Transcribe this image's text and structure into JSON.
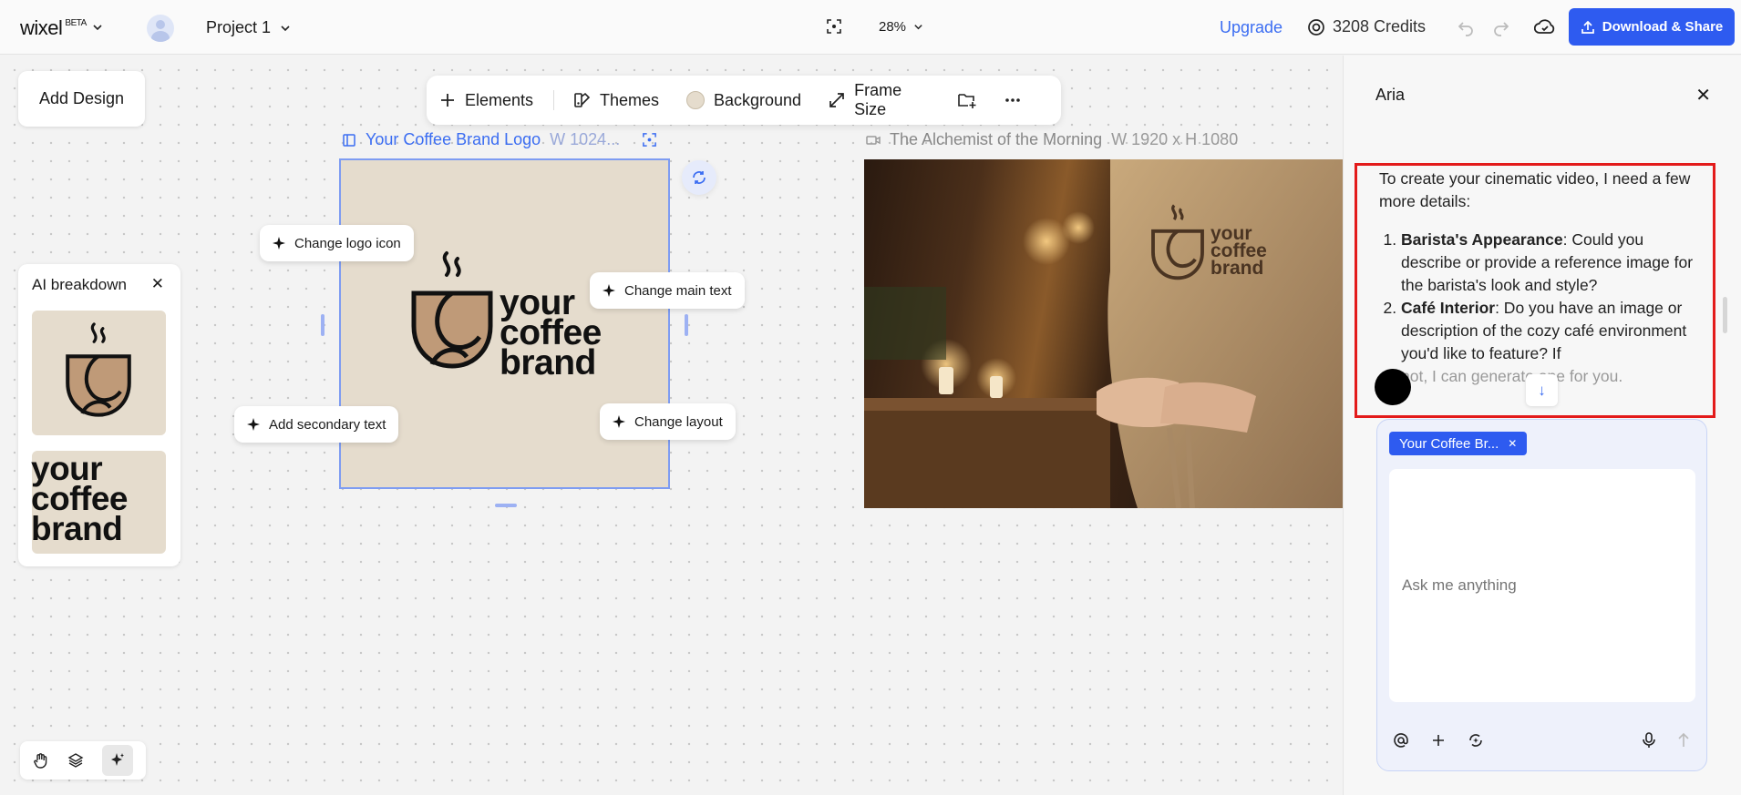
{
  "header": {
    "app_name": "wixel",
    "beta": "BETA",
    "project_name": "Project 1",
    "zoom": "28%",
    "upgrade": "Upgrade",
    "credits": "3208 Credits",
    "download_share": "Download & Share"
  },
  "canvas": {
    "add_design": "Add Design",
    "toolbar": {
      "elements": "Elements",
      "themes": "Themes",
      "background": "Background",
      "frame_size": "Frame Size"
    },
    "frame1": {
      "title": "Your Coffee Brand Logo",
      "dims": "W 1024...",
      "brand_line1": "your",
      "brand_line2": "coffee",
      "brand_line3": "brand"
    },
    "frame2": {
      "title": "The Alchemist of the Morning",
      "dims": "W 1920 x H 1080",
      "apron_line1": "your",
      "apron_line2": "coffee",
      "apron_line3": "brand"
    },
    "chips": {
      "change_logo_icon": "Change logo icon",
      "change_main_text": "Change main text",
      "add_secondary_text": "Add secondary text",
      "change_layout": "Change layout"
    },
    "ai_breakdown": {
      "title": "AI breakdown",
      "text_line1": "your",
      "text_line2": "coffee",
      "text_line3": "brand"
    }
  },
  "panel": {
    "title": "Aria",
    "intro": "To create your cinematic video, I need a few more details:",
    "items": [
      {
        "bold": "Barista's Appearance",
        "text": ": Could you describe or provide a reference image for the barista's look and style?"
      },
      {
        "bold": "Café Interior",
        "text": ": Do you have an image or description of the cozy café environment you'd like to feature? If"
      },
      {
        "bold": "",
        "text": "not, I can generate one for you."
      }
    ],
    "attached_tag": "Your Coffee Br...",
    "input_placeholder": "Ask me anything",
    "input_value": ""
  },
  "colors": {
    "accent": "#2e5bf0",
    "highlight_border": "#e31b1b",
    "frame_bg": "#e5dccd"
  },
  "icons": [
    "chevron-down-icon",
    "focus-icon",
    "credits-icon",
    "undo-icon",
    "redo-icon",
    "cloud-icon",
    "upload-icon",
    "plus-icon",
    "themes-icon",
    "expand-icon",
    "folder-add-icon",
    "more-icon",
    "sparkle-icon",
    "regenerate-icon",
    "close-icon",
    "hand-icon",
    "layers-icon",
    "ai-icon",
    "at-icon",
    "mic-icon",
    "send-icon",
    "arrow-down-icon"
  ]
}
